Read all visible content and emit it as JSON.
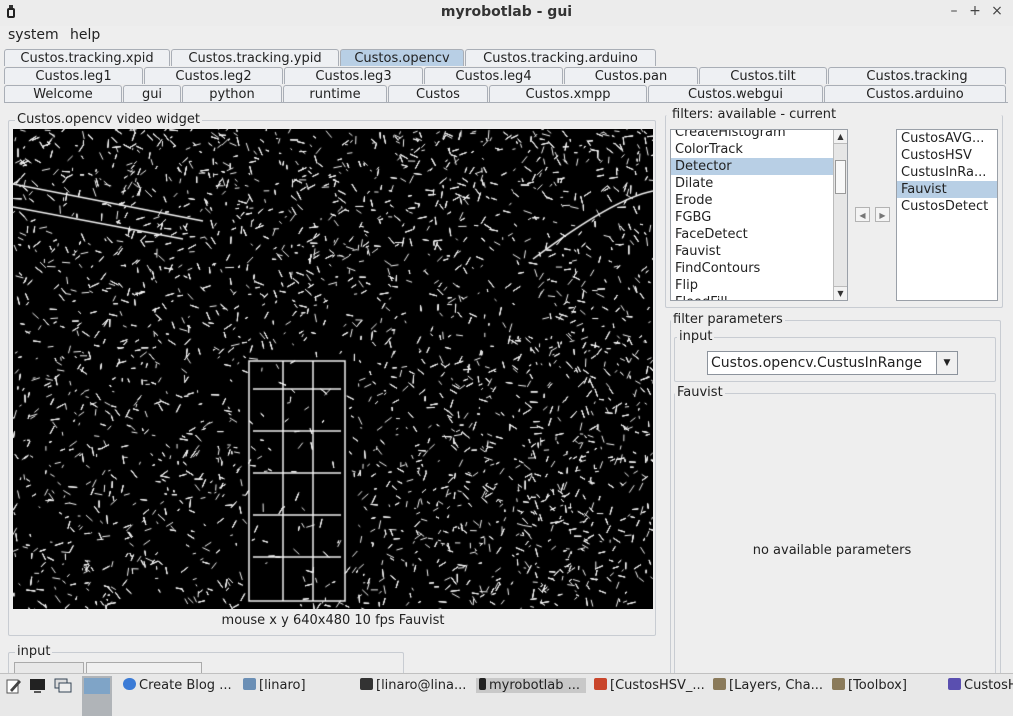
{
  "window": {
    "title": "myrobotlab - gui",
    "min_glyph": "–",
    "max_glyph": "+",
    "close_glyph": "×"
  },
  "menu": [
    "system",
    "help"
  ],
  "tabs": {
    "row1": [
      "Custos.tracking.xpid",
      "Custos.tracking.ypid",
      "Custos.opencv",
      "Custos.tracking.arduino"
    ],
    "row2": [
      "Custos.leg1",
      "Custos.leg2",
      "Custos.leg3",
      "Custos.leg4",
      "Custos.pan",
      "Custos.tilt",
      "Custos.tracking"
    ],
    "row3": [
      "Welcome",
      "gui",
      "python",
      "runtime",
      "Custos",
      "Custos.xmpp",
      "Custos.webgui",
      "Custos.arduino"
    ],
    "selected": "Custos.opencv"
  },
  "video": {
    "title": "Custos.opencv  video widget",
    "status": "mouse x y  640x480 10 fps Fauvist"
  },
  "filters": {
    "title": "filters: available - current",
    "available": [
      "CreateHistogram",
      "ColorTrack",
      "Detector",
      "Dilate",
      "Erode",
      "FGBG",
      "FaceDetect",
      "Fauvist",
      "FindContours",
      "Flip",
      "FloodFill"
    ],
    "available_selected": "Detector",
    "current": [
      "CustosAVG...",
      "CustosHSV",
      "CustusInRa...",
      "Fauvist",
      "CustosDetect"
    ],
    "current_selected": "Fauvist"
  },
  "params": {
    "title": "filter parameters",
    "input_title": "input",
    "input_value": "Custos.opencv.CustusInRange",
    "filter_title": "Fauvist",
    "message": "no available parameters"
  },
  "bottom_input": {
    "title": "input"
  },
  "taskbar": {
    "items": [
      "Create Blog ...",
      "[linaro]",
      "[linaro@lina...",
      "myrobotlab ...",
      "[CustosHSV_...",
      "[Layers, Cha...",
      "[Toolbox]",
      "CustosH"
    ],
    "active": "myrobotlab ..."
  }
}
